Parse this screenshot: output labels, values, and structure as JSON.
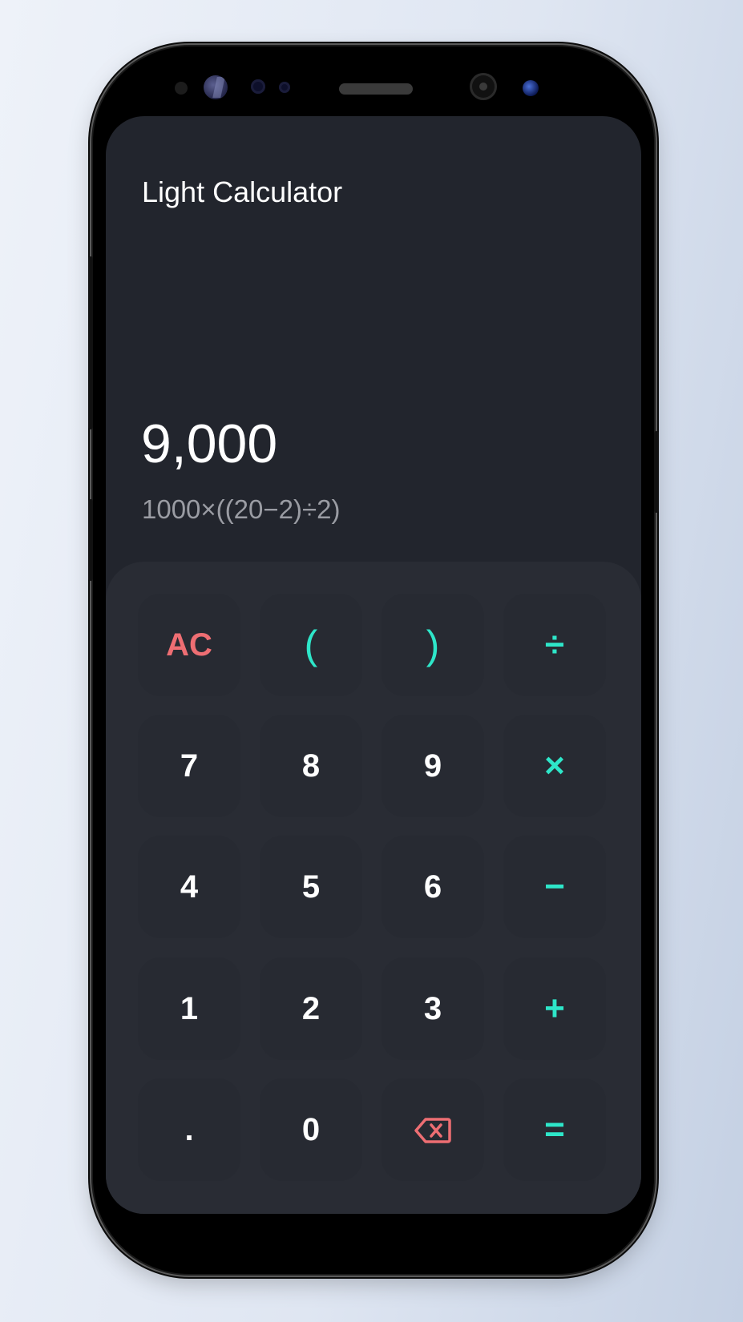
{
  "app": {
    "title": "Light Calculator"
  },
  "display": {
    "result": "9,000",
    "expression": "1000×((20−2)÷2)"
  },
  "keys": {
    "clear": "AC",
    "open_paren": "(",
    "close_paren": ")",
    "divide": "÷",
    "seven": "7",
    "eight": "8",
    "nine": "9",
    "multiply": "×",
    "four": "4",
    "five": "5",
    "six": "6",
    "subtract": "−",
    "one": "1",
    "two": "2",
    "three": "3",
    "add": "+",
    "decimal": ".",
    "zero": "0",
    "backspace_icon": "backspace-icon",
    "equals": "="
  },
  "colors": {
    "screen_background": "#22252d",
    "keypad_background": "#292c34",
    "accent_operator": "#2ee6c9",
    "accent_clear": "#ee6e73",
    "text_primary": "#ffffff",
    "text_secondary": "#9a9ca3"
  }
}
